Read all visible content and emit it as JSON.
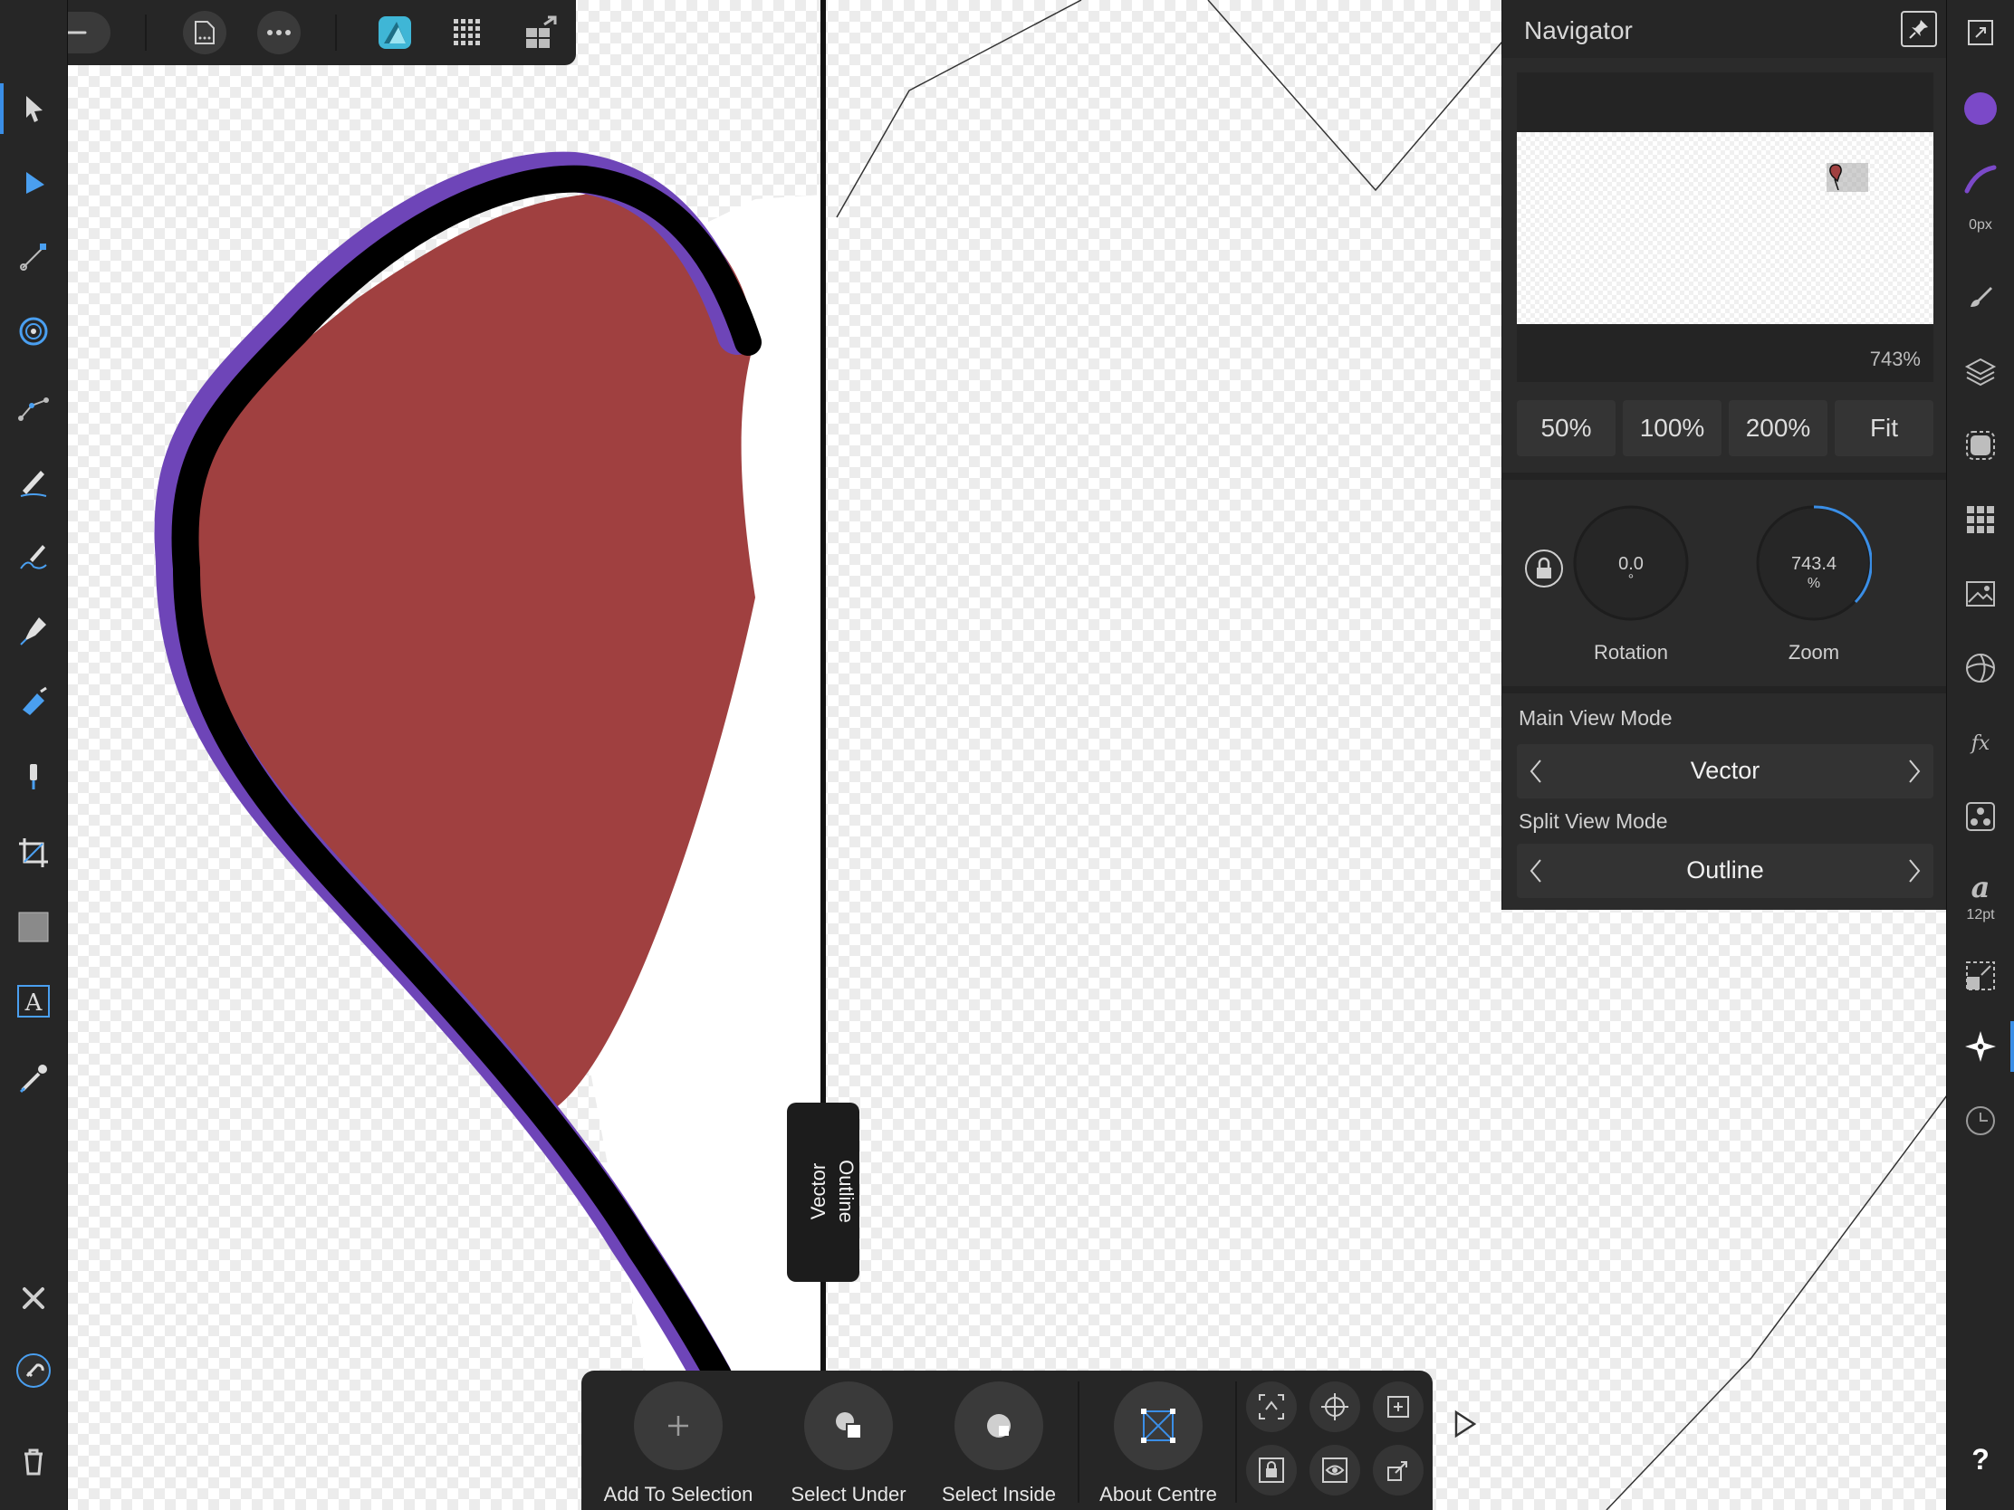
{
  "navigator": {
    "title": "Navigator",
    "zoom_readout": "743%",
    "presets": [
      "50%",
      "100%",
      "200%",
      "Fit"
    ],
    "rotation": {
      "value": "0.0",
      "unit": "°",
      "label": "Rotation"
    },
    "zoom": {
      "value": "743.4",
      "unit": "%",
      "label": "Zoom"
    },
    "main_view_mode": {
      "label": "Main View Mode",
      "value": "Vector"
    },
    "split_view_mode": {
      "label": "Split View Mode",
      "value": "Outline"
    }
  },
  "split_view": {
    "left_label": "Vector",
    "right_label": "Outline"
  },
  "context_toolbar": {
    "add_to_selection": "Add To Selection",
    "select_under": "Select Under",
    "select_inside": "Select Inside",
    "about_centre": "About Centre"
  },
  "right_toolbar": {
    "stroke_width": "0px",
    "font_size": "12pt",
    "help": "?"
  },
  "colors": {
    "fill": "#a04040",
    "stroke_outer": "#6e45b8",
    "stroke_inner": "#000000",
    "accent": "#3a8ee6",
    "fill_swatch": "#7b49c8"
  }
}
